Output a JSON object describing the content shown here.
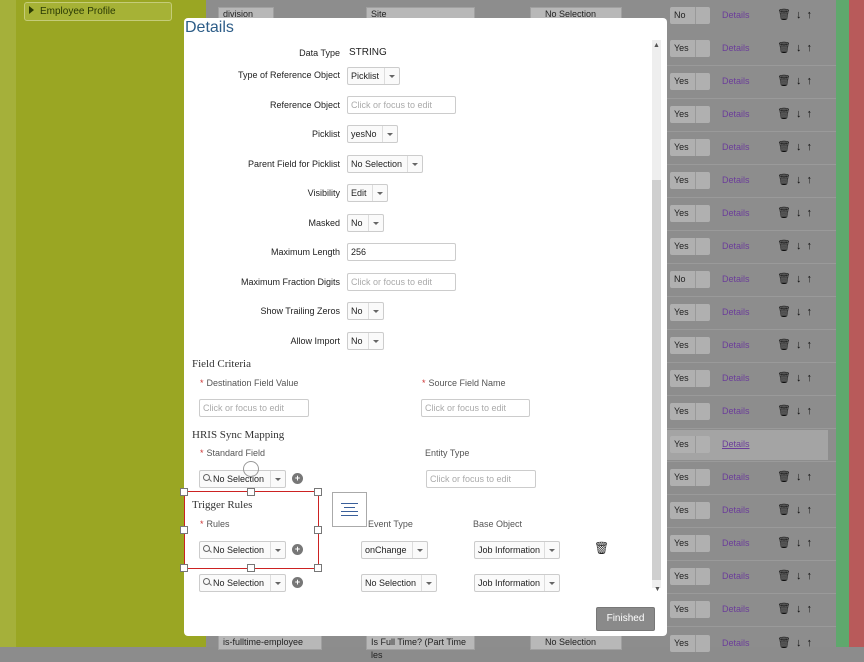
{
  "background": {
    "sidebar_item": "Employee Profile",
    "top_row": {
      "field1": "division",
      "field2": "Site",
      "selection": "No Selection",
      "yes_no": "No",
      "link": "Details"
    },
    "rows": [
      {
        "value": "Yes",
        "link": "Details"
      },
      {
        "value": "Yes",
        "link": "Details"
      },
      {
        "value": "Yes",
        "link": "Details"
      },
      {
        "value": "Yes",
        "link": "Details"
      },
      {
        "value": "Yes",
        "link": "Details"
      },
      {
        "value": "Yes",
        "link": "Details"
      },
      {
        "value": "Yes",
        "link": "Details"
      },
      {
        "value": "No",
        "link": "Details"
      },
      {
        "value": "Yes",
        "link": "Details"
      },
      {
        "value": "Yes",
        "link": "Details"
      },
      {
        "value": "Yes",
        "link": "Details"
      },
      {
        "value": "Yes",
        "link": "Details"
      },
      {
        "value": "Yes",
        "link": "Details"
      },
      {
        "value": "Yes",
        "link": "Details"
      },
      {
        "value": "Yes",
        "link": "Details"
      },
      {
        "value": "Yes",
        "link": "Details"
      },
      {
        "value": "Yes",
        "link": "Details"
      },
      {
        "value": "Yes",
        "link": "Details"
      }
    ],
    "bottom_row": {
      "field1": "is-fulltime-employee",
      "field2": "Is Full Time? (Part Time les",
      "selection": "No Selection",
      "value": "Yes",
      "link": "Details"
    }
  },
  "modal": {
    "title": "Details",
    "fields": {
      "data_type_label": "Data Type",
      "data_type_value": "STRING",
      "ref_type_label": "Type of Reference Object",
      "ref_type_value": "Picklist",
      "ref_obj_label": "Reference Object",
      "ref_obj_placeholder": "Click or focus to edit",
      "picklist_label": "Picklist",
      "picklist_value": "yesNo",
      "parent_label": "Parent Field for Picklist",
      "parent_value": "No Selection",
      "visibility_label": "Visibility",
      "visibility_value": "Edit",
      "masked_label": "Masked",
      "masked_value": "No",
      "maxlen_label": "Maximum Length",
      "maxlen_value": "256",
      "maxfrac_label": "Maximum Fraction Digits",
      "maxfrac_placeholder": "Click or focus to edit",
      "trailing_label": "Show Trailing Zeros",
      "trailing_value": "No",
      "import_label": "Allow Import",
      "import_value": "No"
    },
    "field_criteria": {
      "title": "Field Criteria",
      "dest_label": "Destination Field Value",
      "source_label": "Source Field Name",
      "placeholder": "Click or focus to edit"
    },
    "hris": {
      "title": "HRIS Sync Mapping",
      "standard_label": "Standard Field",
      "standard_value": "No Selection",
      "entity_label": "Entity Type",
      "entity_placeholder": "Click or focus to edit"
    },
    "trigger": {
      "title": "Trigger Rules",
      "rules_label": "Rules",
      "event_label": "Event Type",
      "base_label": "Base Object",
      "rows": [
        {
          "rule": "No Selection",
          "event": "onChange",
          "base": "Job Information"
        },
        {
          "rule": "No Selection",
          "event": "No Selection",
          "base": "Job Information"
        }
      ]
    },
    "finished_label": "Finished"
  }
}
